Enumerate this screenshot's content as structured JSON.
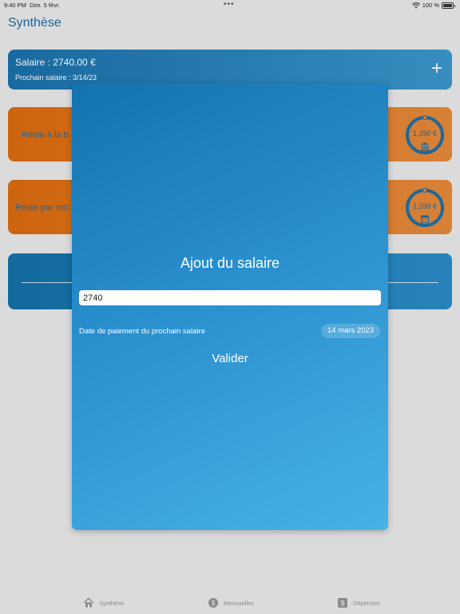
{
  "status": {
    "time": "9:40 PM",
    "date": "Dim. 5 févr.",
    "battery": "100 %",
    "dots": "•••"
  },
  "page": {
    "title": "Synthèse"
  },
  "salary_card": {
    "title": "Salaire : 2740.00 €",
    "next_label": "Prochain salaire :  3/14/23",
    "add_icon": "+"
  },
  "bank_card": {
    "label": "Reste à la b",
    "gauge_value": "1,390 €",
    "icon": "bank-icon"
  },
  "month_card": {
    "label": "Reste par mo",
    "gauge_value": "1,199 €",
    "icon": "calendar-icon"
  },
  "modal": {
    "title": "Ajout du salaire",
    "input_value": "2740",
    "date_label": "Date de paiement du prochain salaire",
    "date_value": "14 mars 2023",
    "validate": "Valider"
  },
  "tabs": [
    {
      "label": "Synthèse",
      "icon": "house-icon"
    },
    {
      "label": "Mensuelles",
      "icon": "coin-icon"
    },
    {
      "label": "Dépenses",
      "icon": "dollar-square-icon"
    }
  ],
  "colors": {
    "accent": "#1e6aa3",
    "orange": "#d96a10",
    "modal_top": "#1473b0",
    "modal_bottom": "#46b2e8"
  }
}
